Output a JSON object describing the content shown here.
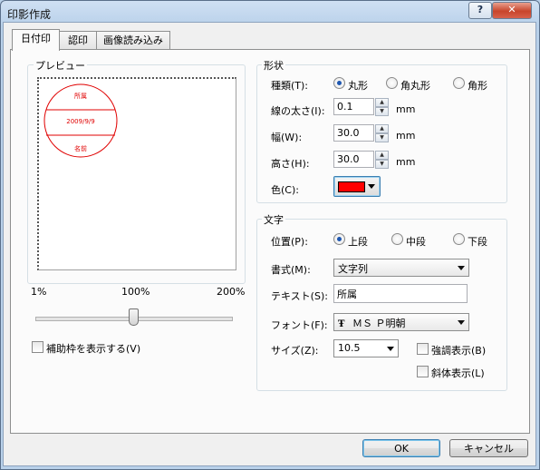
{
  "window": {
    "title": "印影作成",
    "help_label": "?",
    "close_label": "✕"
  },
  "tabs": [
    {
      "label": "日付印",
      "active": true
    },
    {
      "label": "認印",
      "active": false
    },
    {
      "label": "画像読み込み",
      "active": false
    }
  ],
  "preview": {
    "group_label": "プレビュー",
    "stamp": {
      "top": "所属",
      "middle": "2009/9/9",
      "bottom": "名前",
      "color": "#e00000"
    },
    "zoom": {
      "min_label": "1%",
      "mid_label": "100%",
      "max_label": "200%",
      "value_percent": 100
    },
    "guide_checkbox": {
      "label": "補助枠を表示する(V)",
      "checked": false
    }
  },
  "shape": {
    "group_label": "形状",
    "type_label": "種類(T):",
    "types": [
      {
        "label": "丸形",
        "selected": true
      },
      {
        "label": "角丸形",
        "selected": false
      },
      {
        "label": "角形",
        "selected": false
      }
    ],
    "line_width": {
      "label": "線の太さ(I):",
      "value": "0.1",
      "unit": "mm"
    },
    "width": {
      "label": "幅(W):",
      "value": "30.0",
      "unit": "mm"
    },
    "height": {
      "label": "高さ(H):",
      "value": "30.0",
      "unit": "mm"
    },
    "color": {
      "label": "色(C):",
      "value": "#ff0000"
    }
  },
  "text": {
    "group_label": "文字",
    "position_label": "位置(P):",
    "positions": [
      {
        "label": "上段",
        "selected": true
      },
      {
        "label": "中段",
        "selected": false
      },
      {
        "label": "下段",
        "selected": false
      }
    ],
    "format": {
      "label": "書式(M):",
      "value": "文字列"
    },
    "text": {
      "label": "テキスト(S):",
      "value": "所属"
    },
    "font": {
      "label": "フォント(F):",
      "icon": "truetype-font-icon",
      "value": "ＭＳ Ｐ明朝"
    },
    "size": {
      "label": "サイズ(Z):",
      "value": "10.5"
    },
    "bold": {
      "label": "強調表示(B)",
      "checked": false
    },
    "italic": {
      "label": "斜体表示(L)",
      "checked": false
    }
  },
  "footer": {
    "ok_label": "OK",
    "cancel_label": "キャンセル"
  }
}
